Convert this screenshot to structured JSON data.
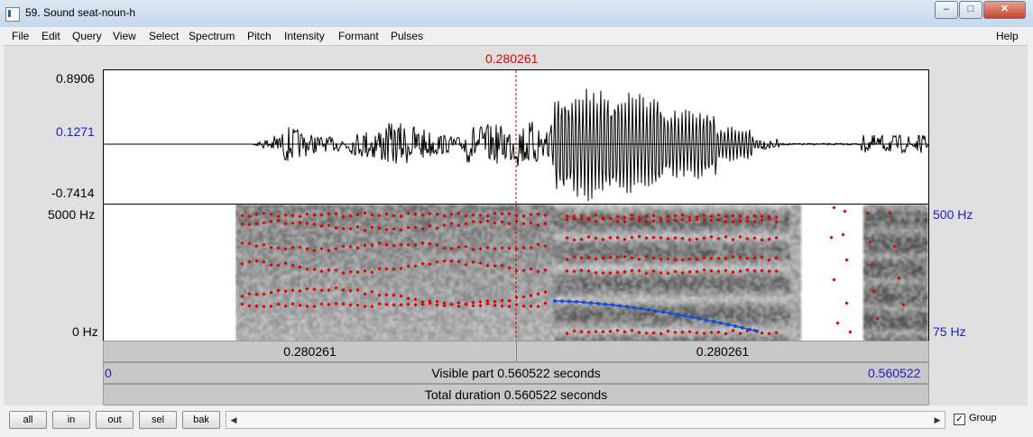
{
  "window": {
    "title": "59. Sound seat-noun-h",
    "minimize_label": "–",
    "maximize_label": "□",
    "close_label": "✕"
  },
  "menu": [
    "File",
    "Edit",
    "Query",
    "View",
    "Select",
    "Spectrum",
    "Pitch",
    "Intensity",
    "Formant",
    "Pulses"
  ],
  "help_label": "Help",
  "cursor": {
    "time_label": "0.280261"
  },
  "waveform": {
    "y_max_label": "0.8906",
    "y_mid_label": "0.1271",
    "y_min_label": "-0.7414"
  },
  "spectrogram": {
    "freq_max_label": "5000 Hz",
    "freq_min_label": "0 Hz",
    "pitch_max_label": "500 Hz",
    "pitch_min_label": "75 Hz",
    "formant_color": "#e00000",
    "pitch_color": "#1050d8"
  },
  "time_bars": {
    "left_segment_label": "0.280261",
    "right_segment_label": "0.280261",
    "visible_start_label": "0",
    "visible_part_label": "Visible part 0.560522 seconds",
    "visible_end_label": "0.560522",
    "total_duration_label": "Total duration 0.560522 seconds"
  },
  "toolbar": {
    "buttons": [
      "all",
      "in",
      "out",
      "sel",
      "bak"
    ],
    "group_label": "Group",
    "group_checked": true,
    "check_mark": "✓"
  }
}
